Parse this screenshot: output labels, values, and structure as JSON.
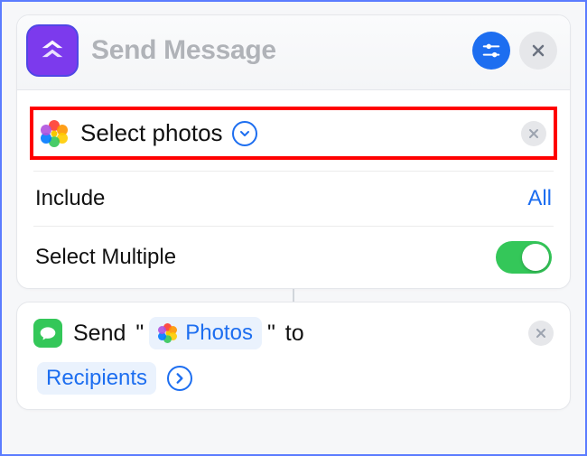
{
  "header": {
    "title": "Send Message"
  },
  "select_photos": {
    "title": "Select photos",
    "include_label": "Include",
    "include_value": "All",
    "multiple_label": "Select Multiple",
    "multiple_on": true
  },
  "send_action": {
    "verb": "Send",
    "photos_token": "Photos",
    "to_word": "to",
    "recipients_token": "Recipients"
  },
  "icons": {
    "shortcut": "shortcuts-app-icon",
    "settings": "settings-sliders-icon",
    "close": "close-x-icon",
    "photos": "photos-flower-icon",
    "messages": "messages-bubble-icon",
    "chevron_down": "chevron-down-icon",
    "chevron_right": "chevron-right-icon",
    "remove": "remove-x-icon"
  },
  "colors": {
    "accent_blue": "#1d6ef0",
    "purple": "#7c3aed",
    "green": "#34c759",
    "highlight_red": "#ff0000"
  }
}
